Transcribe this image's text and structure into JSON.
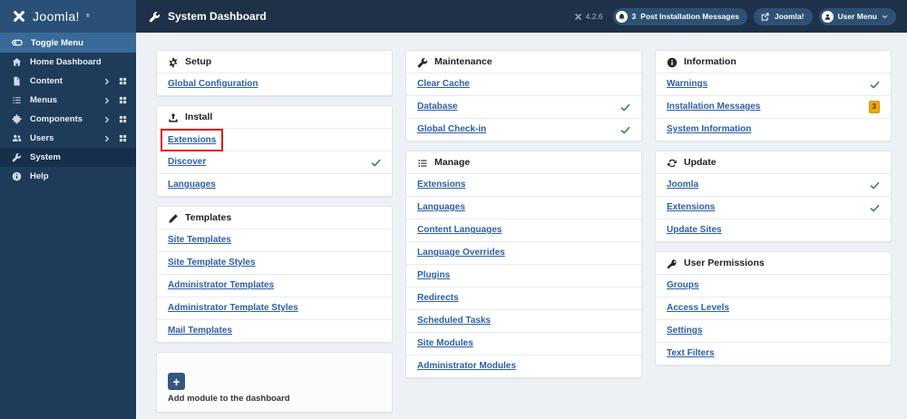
{
  "colors": {
    "header_bg": "#1f3148",
    "logo_bg": "#2b5077",
    "sidebar_bg": "#1e3c59",
    "sidebar_active_bg": "#16304b",
    "toggle_bg": "#3a6a99",
    "pill_bg": "#2d5174",
    "page_bg": "#edf1f6",
    "card_border": "#dfe4e9",
    "link": "#2c5faa",
    "check_green": "#2e8540",
    "badge_bg": "#f1a70a",
    "annotation_red": "#e0191c"
  },
  "header": {
    "logo_text": "Joomla!",
    "logo_mark": "®",
    "title": "System Dashboard",
    "version": "4.2.6",
    "post_install_count": "3",
    "post_install_label": "Post Installation Messages",
    "joomla_button_label": "Joomla!",
    "user_menu_label": "User Menu"
  },
  "sidebar": {
    "toggle_label": "Toggle Menu",
    "items": [
      {
        "label": "Home Dashboard",
        "icon": "home",
        "submenu": false,
        "grid": false,
        "active": false
      },
      {
        "label": "Content",
        "icon": "file",
        "submenu": true,
        "grid": true,
        "active": false
      },
      {
        "label": "Menus",
        "icon": "bars",
        "submenu": true,
        "grid": true,
        "active": false
      },
      {
        "label": "Components",
        "icon": "puzzle",
        "submenu": true,
        "grid": true,
        "active": false
      },
      {
        "label": "Users",
        "icon": "users",
        "submenu": true,
        "grid": true,
        "active": false
      },
      {
        "label": "System",
        "icon": "wrench",
        "submenu": false,
        "grid": false,
        "active": true
      },
      {
        "label": "Help",
        "icon": "info",
        "submenu": false,
        "grid": false,
        "active": false
      }
    ]
  },
  "columns": [
    {
      "cards": [
        {
          "title": "Setup",
          "icon": "gear",
          "rows": [
            {
              "label": "Global Configuration"
            }
          ]
        },
        {
          "title": "Install",
          "icon": "upload",
          "rows": [
            {
              "label": "Extensions",
              "annotated": true
            },
            {
              "label": "Discover",
              "check": true
            },
            {
              "label": "Languages"
            }
          ]
        },
        {
          "title": "Templates",
          "icon": "pen",
          "rows": [
            {
              "label": "Site Templates"
            },
            {
              "label": "Site Template Styles"
            },
            {
              "label": "Administrator Templates"
            },
            {
              "label": "Administrator Template Styles"
            },
            {
              "label": "Mail Templates"
            }
          ]
        }
      ]
    },
    {
      "cards": [
        {
          "title": "Maintenance",
          "icon": "wrench",
          "rows": [
            {
              "label": "Clear Cache"
            },
            {
              "label": "Database",
              "check": true
            },
            {
              "label": "Global Check-in",
              "check": true
            }
          ]
        },
        {
          "title": "Manage",
          "icon": "list",
          "rows": [
            {
              "label": "Extensions"
            },
            {
              "label": "Languages"
            },
            {
              "label": "Content Languages"
            },
            {
              "label": "Language Overrides"
            },
            {
              "label": "Plugins"
            },
            {
              "label": "Redirects"
            },
            {
              "label": "Scheduled Tasks"
            },
            {
              "label": "Site Modules"
            },
            {
              "label": "Administrator Modules"
            }
          ]
        }
      ]
    },
    {
      "cards": [
        {
          "title": "Information",
          "icon": "info",
          "rows": [
            {
              "label": "Warnings",
              "check": true
            },
            {
              "label": "Installation Messages",
              "badge": "3"
            },
            {
              "label": "System Information"
            }
          ]
        },
        {
          "title": "Update",
          "icon": "rotate",
          "rows": [
            {
              "label": "Joomla",
              "check": true
            },
            {
              "label": "Extensions",
              "check": true
            },
            {
              "label": "Update Sites"
            }
          ]
        },
        {
          "title": "User Permissions",
          "icon": "key",
          "rows": [
            {
              "label": "Groups"
            },
            {
              "label": "Access Levels"
            },
            {
              "label": "Settings"
            },
            {
              "label": "Text Filters"
            }
          ]
        }
      ]
    }
  ],
  "add_module": {
    "plus_label": "+",
    "label": "Add module to the dashboard"
  }
}
